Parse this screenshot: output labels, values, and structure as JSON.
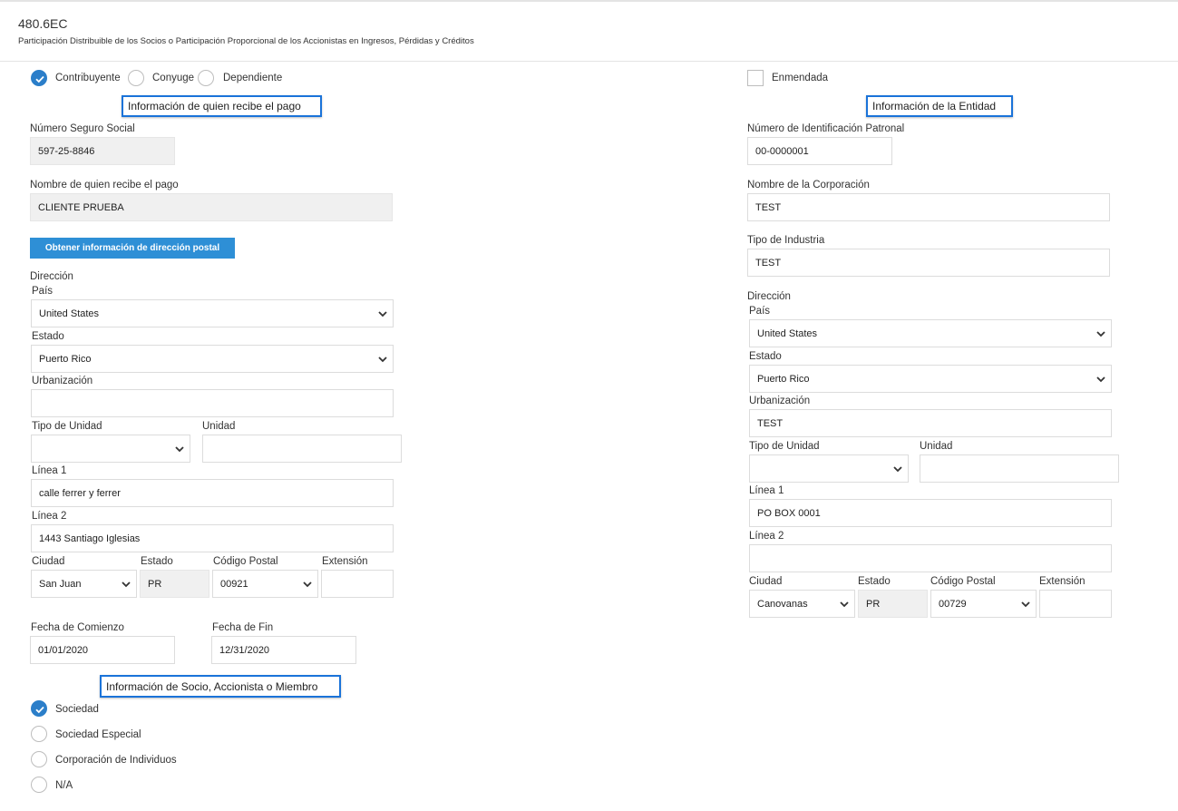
{
  "header": {
    "code": "480.6EC",
    "subtitle": "Participación Distribuible de los Socios o Participación Proporcional de los Accionistas en Ingresos, Pérdidas y Créditos"
  },
  "filer_options": [
    {
      "label": "Contribuyente",
      "checked": true
    },
    {
      "label": "Conyuge",
      "checked": false
    },
    {
      "label": "Dependiente",
      "checked": false
    }
  ],
  "amended": {
    "label": "Enmendada",
    "checked": false
  },
  "recipient": {
    "section_title": "Información de quien recibe el pago",
    "ssn_label": "Número Seguro Social",
    "ssn_value": "597-25-8846",
    "name_label": "Nombre de quien recibe el pago",
    "name_value": "CLIENTE PRUEBA",
    "get_address_button": "Obtener información de dirección postal",
    "address_label": "Dirección",
    "country_label": "País",
    "country_value": "United States",
    "state_label": "Estado",
    "state_value": "Puerto Rico",
    "urbanization_label": "Urbanización",
    "urbanization_value": "",
    "unit_type_label": "Tipo de Unidad",
    "unit_type_value": "",
    "unit_label": "Unidad",
    "unit_value": "",
    "line1_label": "Línea 1",
    "line1_value": "calle ferrer y ferrer",
    "line2_label": "Línea 2",
    "line2_value": "1443 Santiago Iglesias",
    "city_label": "Ciudad",
    "city_value": "San Juan",
    "state_code_label": "Estado",
    "state_code_value": "PR",
    "zip_label": "Código Postal",
    "zip_value": "00921",
    "ext_label": "Extensión",
    "ext_value": "",
    "start_date_label": "Fecha de Comienzo",
    "start_date_value": "01/01/2020",
    "end_date_label": "Fecha de Fin",
    "end_date_value": "12/31/2020"
  },
  "entity": {
    "section_title": "Información de la Entidad",
    "ein_label": "Número de Identificación Patronal",
    "ein_value": "00-0000001",
    "corp_name_label": "Nombre de la Corporación",
    "corp_name_value": "TEST",
    "industry_label": "Tipo de Industria",
    "industry_value": "TEST",
    "address_label": "Dirección",
    "country_label": "País",
    "country_value": "United States",
    "state_label": "Estado",
    "state_value": "Puerto Rico",
    "urbanization_label": "Urbanización",
    "urbanization_value": "TEST",
    "unit_type_label": "Tipo de Unidad",
    "unit_type_value": "",
    "unit_label": "Unidad",
    "unit_value": "",
    "line1_label": "Línea 1",
    "line1_value": "PO BOX 0001",
    "line2_label": "Línea 2",
    "line2_value": "",
    "city_label": "Ciudad",
    "city_value": "Canovanas",
    "state_code_label": "Estado",
    "state_code_value": "PR",
    "zip_label": "Código Postal",
    "zip_value": "00729",
    "ext_label": "Extensión",
    "ext_value": ""
  },
  "member": {
    "section_title": "Información de Socio, Accionista o Miembro",
    "options": [
      {
        "label": "Sociedad",
        "checked": true
      },
      {
        "label": "Sociedad Especial",
        "checked": false
      },
      {
        "label": "Corporación de Individuos",
        "checked": false
      },
      {
        "label": "N/A",
        "checked": false
      }
    ]
  },
  "colors": {
    "accent": "#2b7ec9",
    "button": "#2e8fd6",
    "section_border": "#1a73d9"
  }
}
